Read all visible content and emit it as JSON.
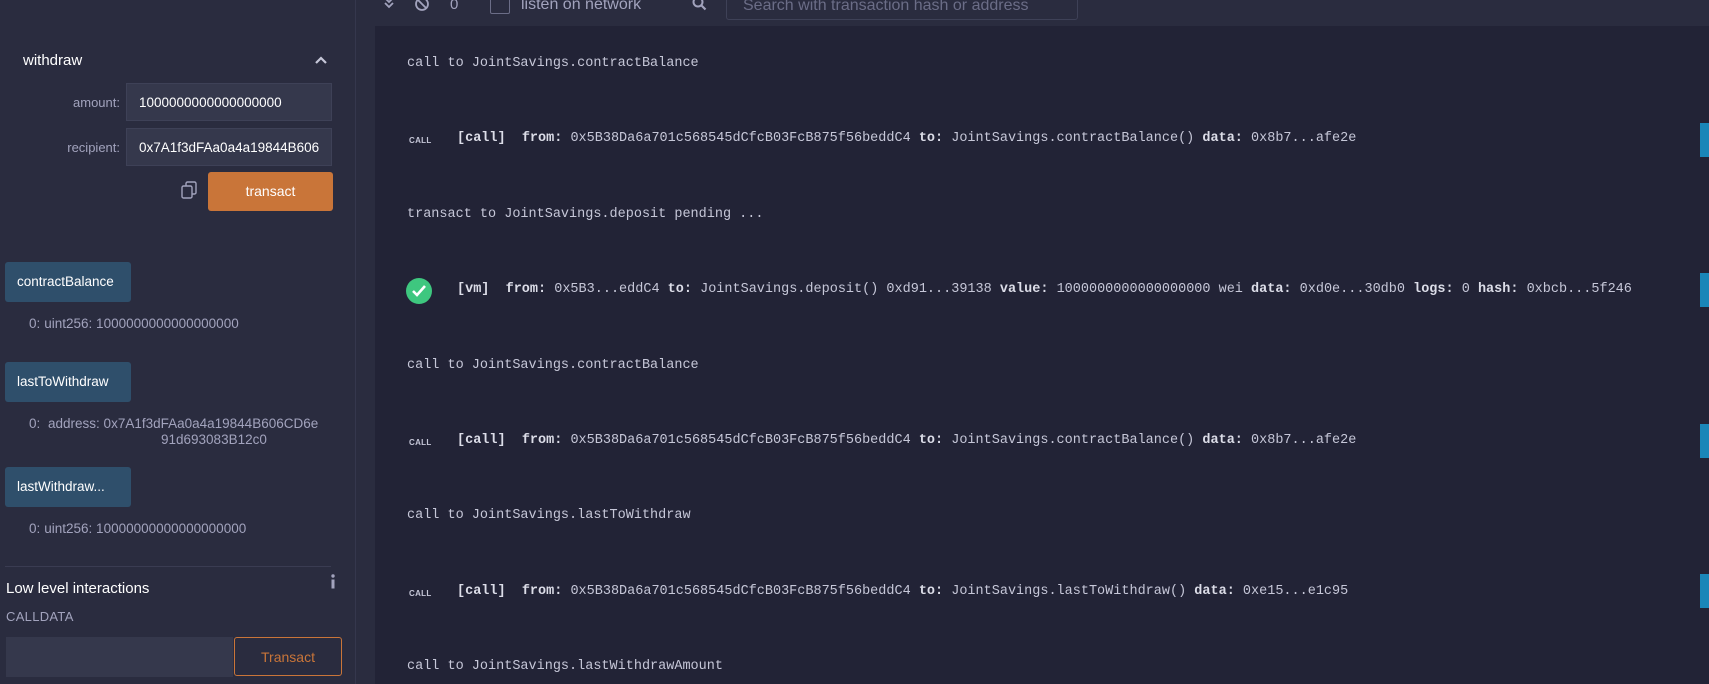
{
  "left": {
    "withdraw": {
      "title": "withdraw",
      "amount_label": "amount:",
      "amount_value": "1000000000000000000",
      "recipient_label": "recipient:",
      "recipient_value": "0x7A1f3dFAa0a4a19844B606",
      "transact_label": "transact"
    },
    "functions": [
      {
        "label": "contractBalance",
        "result_index": "0:",
        "result": "uint256: 1000000000000000000"
      },
      {
        "label": "lastToWithdraw",
        "result_index": "0:",
        "result": "address: 0x7A1f3dFAa0a4a19844B606CD6e",
        "result_line2": "91d693083B12c0"
      },
      {
        "label": "lastWithdraw...",
        "result_index": "0:",
        "result": "uint256: 10000000000000000000"
      }
    ],
    "low_level": {
      "title": "Low level interactions",
      "calldata_label": "CALLDATA",
      "transact_label": "Transact"
    }
  },
  "toolbar": {
    "count": "0",
    "listen_label": "listen on network",
    "search_placeholder": "Search with transaction hash or address"
  },
  "logs": [
    {
      "type": "text",
      "text": "call to JointSavings.contractBalance"
    },
    {
      "type": "tx",
      "badge": "CALL",
      "kind": "[call]",
      "segments": [
        {
          "k": "from:",
          "v": "0x5B38Da6a701c568545dCfcB03FcB875f56beddC4"
        },
        {
          "k": "to:",
          "v": "JointSavings.contractBalance()"
        },
        {
          "k": "data:",
          "v": "0x8b7...afe2e"
        }
      ]
    },
    {
      "type": "text",
      "text": "transact to JointSavings.deposit pending ..."
    },
    {
      "type": "tx",
      "badge": "ok",
      "kind": "[vm]",
      "segments": [
        {
          "k": "from:",
          "v": "0x5B3...eddC4"
        },
        {
          "k": "to:",
          "v": "JointSavings.deposit() 0xd91...39138"
        },
        {
          "k": "value:",
          "v": "1000000000000000000 wei"
        },
        {
          "k": "data:",
          "v": "0xd0e...30db0"
        },
        {
          "k": "logs:",
          "v": "0"
        },
        {
          "k": "hash:",
          "v": "0xbcb...5f246"
        }
      ]
    },
    {
      "type": "text",
      "text": "call to JointSavings.contractBalance"
    },
    {
      "type": "tx",
      "badge": "CALL",
      "kind": "[call]",
      "segments": [
        {
          "k": "from:",
          "v": "0x5B38Da6a701c568545dCfcB03FcB875f56beddC4"
        },
        {
          "k": "to:",
          "v": "JointSavings.contractBalance()"
        },
        {
          "k": "data:",
          "v": "0x8b7...afe2e"
        }
      ]
    },
    {
      "type": "text",
      "text": "call to JointSavings.lastToWithdraw"
    },
    {
      "type": "tx",
      "badge": "CALL",
      "kind": "[call]",
      "segments": [
        {
          "k": "from:",
          "v": "0x5B38Da6a701c568545dCfcB03FcB875f56beddC4"
        },
        {
          "k": "to:",
          "v": "JointSavings.lastToWithdraw()"
        },
        {
          "k": "data:",
          "v": "0xe15...e1c95"
        }
      ]
    },
    {
      "type": "text",
      "text": "call to JointSavings.lastWithdrawAmount"
    }
  ],
  "colors": {
    "accent": "#c97539",
    "button": "#2f4f6b",
    "success": "#3ec77f",
    "marker": "#1a86b8"
  }
}
